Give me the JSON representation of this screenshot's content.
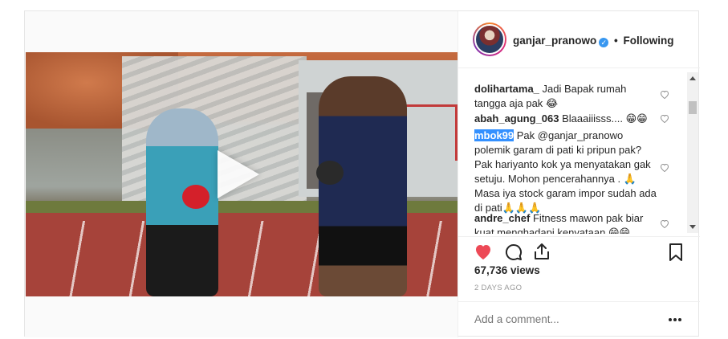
{
  "post": {
    "username": "ganjar_pranowo",
    "verified_symbol": "✓",
    "separator": "•",
    "following_label": "Following",
    "views": "67,736 views",
    "time_ago": "2 DAYS AGO",
    "add_comment_placeholder": "Add a comment...",
    "more_symbol": "..."
  },
  "comments": [
    {
      "user": "dolihartama_",
      "text": " Jadi Bapak rumah tangga aja pak 😂"
    },
    {
      "user": "abah_agung_063",
      "text": " Blaaaiiisss.... 😁😁"
    },
    {
      "user": "mbok99",
      "text": " Pak ",
      "mention": "@ganjar_pranowo",
      "text2": " polemik garam di pati ki pripun pak? Pak hariyanto kok ya menyatakan gak setuju. Mohon pencerahannya . 🙏 Masa iya stock garam impor sudah ada di pati🙏🙏🙏"
    },
    {
      "user": "andre_chef",
      "text": " Fitness mawon pak biar kuat menghadapi kenyataan 😁😁"
    }
  ],
  "icons": {
    "like": "heart-icon",
    "comment": "comment-icon",
    "share": "share-icon",
    "save": "bookmark-icon",
    "play": "play-icon"
  },
  "colors": {
    "like_red": "#ed4956",
    "verified_blue": "#3897f0",
    "selection_blue": "#3390ff"
  }
}
